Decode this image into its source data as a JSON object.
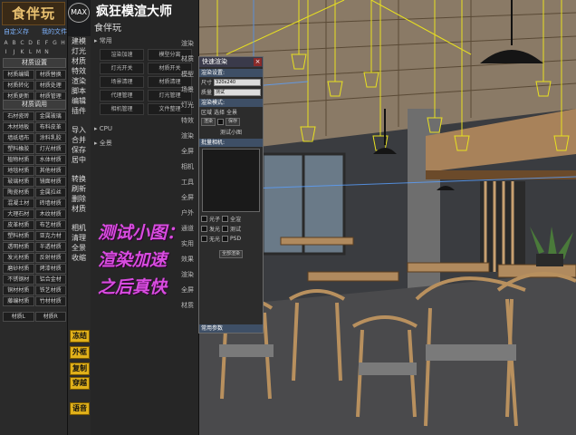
{
  "left_panel": {
    "logo": "食伴玩",
    "badge": "MAX",
    "top_links": [
      "自定义存",
      "我的文件"
    ],
    "alpha": [
      "A",
      "B",
      "C",
      "D",
      "E",
      "F",
      "G",
      "H",
      "I",
      "J",
      "K",
      "L",
      "M",
      "N"
    ],
    "section1_title": "材质设置",
    "section1_buttons": [
      "材质编辑",
      "材质替换",
      "材质转化",
      "材质处理",
      "材质更新",
      "材质管理"
    ],
    "section2_title": "材质调用",
    "section2_buttons": [
      "石材瓷砖",
      "金属玻璃",
      "木材地板",
      "布料皮革",
      "墙纸墙布",
      "涂料乳胶",
      "塑料橡胶",
      "灯光材质",
      "植物材质",
      "水体材质",
      "地毯材质",
      "其他材质",
      "玻璃材质",
      "镜面材质",
      "陶瓷材质",
      "金属拉丝",
      "混凝土材",
      "砖墙材质",
      "大理石材",
      "木纹材质",
      "皮革材质",
      "布艺材质",
      "塑料材质",
      "亚克力材",
      "透明材质",
      "半透材质",
      "发光材质",
      "反射材质",
      "磨砂材质",
      "烤漆材质",
      "不锈钢材",
      "铝合金材",
      "铜材材质",
      "铁艺材质",
      "藤编材质",
      "竹材材质"
    ],
    "bottom_buttons": [
      "材质L",
      "材质R"
    ]
  },
  "strip1": {
    "groups": [
      [
        "建模",
        "灯光",
        "材质",
        "特效",
        "渲染",
        "脚本",
        "编辑",
        "插件"
      ],
      [
        "导入",
        "合并",
        "保存",
        "居中"
      ],
      [
        "转换",
        "刷新",
        "删除",
        "材质"
      ],
      [
        "相机",
        "清理",
        "全景",
        "收缩"
      ]
    ],
    "yellow_buttons": [
      "冻结",
      "外框",
      "复制",
      "穿越",
      "语音"
    ]
  },
  "mid_panel": {
    "title": "疯狂模渲大师",
    "subtitle": "食伴玩",
    "section_label": "常用",
    "grid_buttons": [
      "渲染加速",
      "模型分离",
      "灯光开关",
      "材质开关",
      "场景清理",
      "材质清理",
      "代理管理",
      "灯光管理",
      "相机管理",
      "文件整理"
    ],
    "cpu_label": "CPU",
    "all_label": "全景",
    "vertical_labels": [
      "渲染",
      "材质",
      "模型",
      "场景",
      "灯光",
      "特效",
      "渲染",
      "全屏",
      "相机",
      "工具",
      "全屏",
      "户外",
      "通道",
      "实用",
      "效果",
      "渲染",
      "全屏",
      "材质"
    ]
  },
  "dialog": {
    "title": "快速渲染",
    "section1": "渲染设置:",
    "size_label": "尺寸",
    "size_value": "320x240",
    "quality_label": "质量",
    "quality_value": "测试",
    "section2": "渲染模式:",
    "mode_options": [
      "区域",
      "选择",
      "全景"
    ],
    "render_btn": "渲染",
    "save_btn": "保存",
    "small_label": "测试小图",
    "section3": "批量相机:",
    "opts": [
      "光子",
      "全渲",
      "发光",
      "测试",
      "无光",
      "PSD"
    ],
    "final_btn": "全部渲染",
    "footer": "常用参数"
  },
  "caption": {
    "line1": "测试小图：",
    "line2": "渲染加速",
    "line3": "之后真快"
  }
}
